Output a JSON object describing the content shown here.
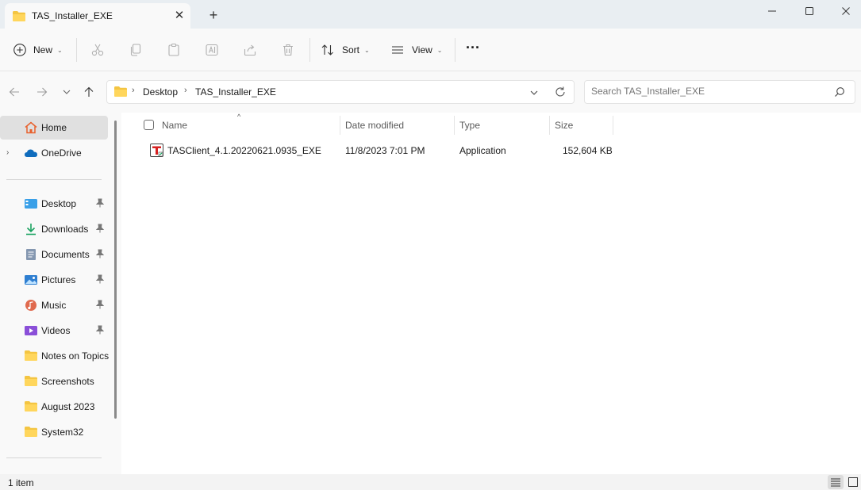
{
  "window": {
    "tab_title": "TAS_Installer_EXE",
    "close_tab_glyph": "✕",
    "new_tab_glyph": "+"
  },
  "toolbar": {
    "new_label": "New",
    "sort_label": "Sort",
    "view_label": "View",
    "more_glyph": "···",
    "icons": [
      "cut-icon",
      "copy-icon",
      "paste-icon",
      "rename-icon",
      "share-icon",
      "delete-icon"
    ]
  },
  "address": {
    "crumbs": [
      "Desktop",
      "TAS_Installer_EXE"
    ],
    "crumb_separator": "›"
  },
  "search": {
    "placeholder": "Search TAS_Installer_EXE"
  },
  "sidebar": {
    "items": [
      {
        "label": "Home",
        "icon": "home-icon",
        "pinned": false
      },
      {
        "label": "OneDrive",
        "icon": "cloud-icon",
        "pinned": false
      },
      {
        "label": "Desktop",
        "icon": "desktop-icon",
        "pinned": true
      },
      {
        "label": "Downloads",
        "icon": "download-icon",
        "pinned": true
      },
      {
        "label": "Documents",
        "icon": "documents-icon",
        "pinned": true
      },
      {
        "label": "Pictures",
        "icon": "pictures-icon",
        "pinned": true
      },
      {
        "label": "Music",
        "icon": "music-icon",
        "pinned": true
      },
      {
        "label": "Videos",
        "icon": "videos-icon",
        "pinned": true
      },
      {
        "label": "Notes on Topics",
        "icon": "folder-icon",
        "pinned": false
      },
      {
        "label": "Screenshots",
        "icon": "folder-icon",
        "pinned": false
      },
      {
        "label": "August 2023",
        "icon": "folder-icon",
        "pinned": false
      },
      {
        "label": "System32",
        "icon": "folder-icon",
        "pinned": false
      }
    ]
  },
  "columns": {
    "name": "Name",
    "date_modified": "Date modified",
    "type": "Type",
    "size": "Size"
  },
  "files": [
    {
      "name": "TASClient_4.1.20220621.0935_EXE",
      "date_modified": "11/8/2023 7:01 PM",
      "type": "Application",
      "size": "152,604 KB"
    }
  ],
  "status": {
    "item_count": "1 item"
  },
  "colors": {
    "accent": "#0067c0",
    "folder": "#f4c542",
    "selected_bg": "#e0e0e0"
  }
}
